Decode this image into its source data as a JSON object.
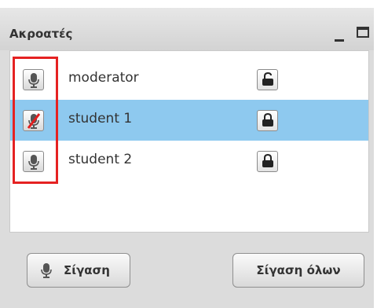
{
  "panel": {
    "title": "Ακροατές"
  },
  "window_controls": [
    "minimize-icon",
    "maximize-icon"
  ],
  "participants": [
    {
      "name": "moderator",
      "mic": "microphone-icon",
      "mic_muted": false,
      "lock": "unlocked-icon",
      "selected": false
    },
    {
      "name": "student 1",
      "mic": "microphone-muted-icon",
      "mic_muted": true,
      "lock": "locked-icon",
      "selected": true
    },
    {
      "name": "student 2",
      "mic": "microphone-icon",
      "mic_muted": false,
      "lock": "locked-icon",
      "selected": false
    }
  ],
  "footer": {
    "mute_label": "Σίγαση",
    "mute_all_label": "Σίγαση όλων"
  },
  "colors": {
    "selected_row": "#8ec9ef",
    "highlight_border": "#e52222",
    "panel_bg": "#dcdcdc"
  }
}
